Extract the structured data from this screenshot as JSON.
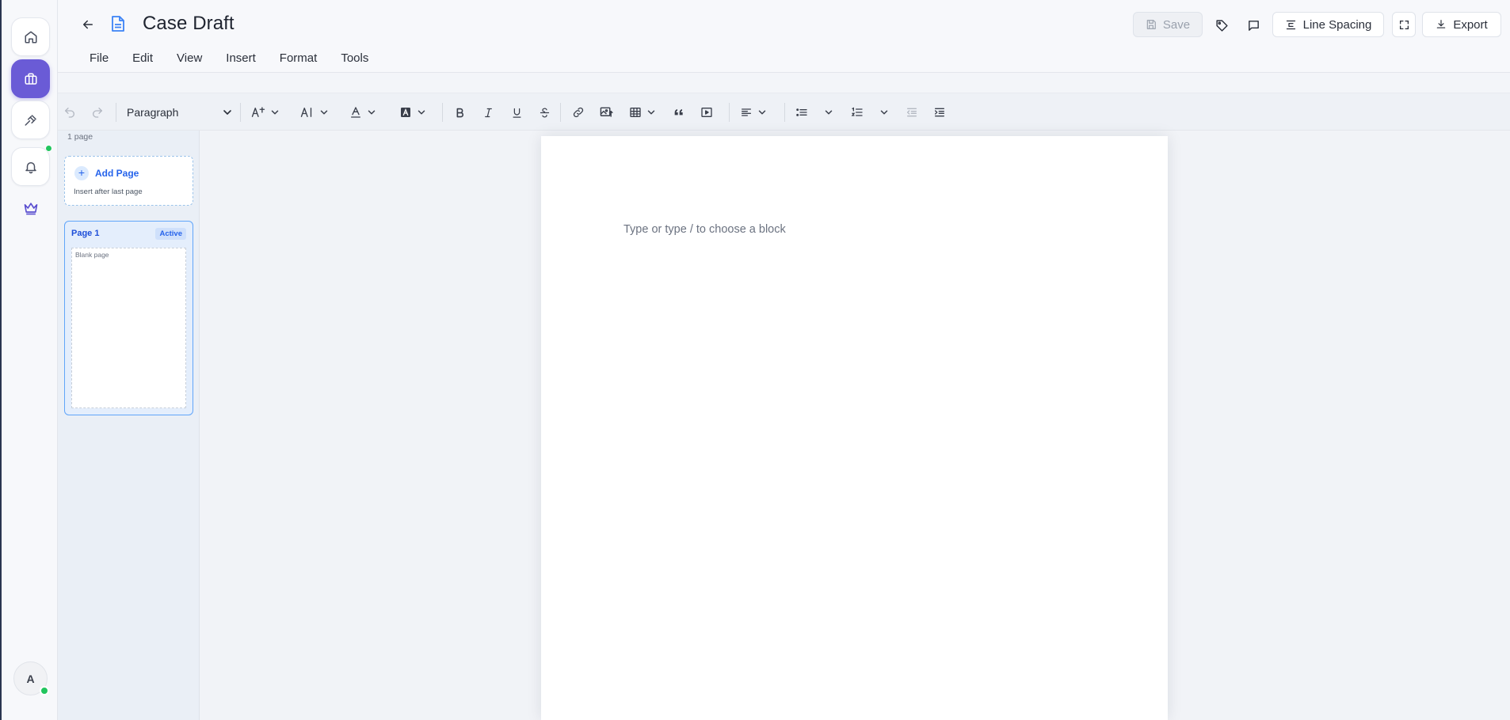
{
  "rail": {
    "items": [
      "home-icon",
      "briefcase-icon",
      "gavel-icon",
      "bell-icon",
      "crown-icon"
    ],
    "avatar_initial": "A",
    "accent": "#6a5bd6"
  },
  "header": {
    "title": "Case Draft",
    "menu": [
      "File",
      "Edit",
      "View",
      "Insert",
      "Format",
      "Tools"
    ],
    "save_label": "Save",
    "line_spacing_label": "Line Spacing",
    "export_label": "Export"
  },
  "toolbar": {
    "block_type": "Paragraph"
  },
  "pages_panel": {
    "count_label": "1 page",
    "add_label": "Add Page",
    "add_sub": "Insert after last page",
    "pages": [
      {
        "name": "Page 1",
        "badge": "Active",
        "thumb_text": "Blank page"
      }
    ]
  },
  "editor": {
    "placeholder": "Type or type / to choose a block"
  }
}
